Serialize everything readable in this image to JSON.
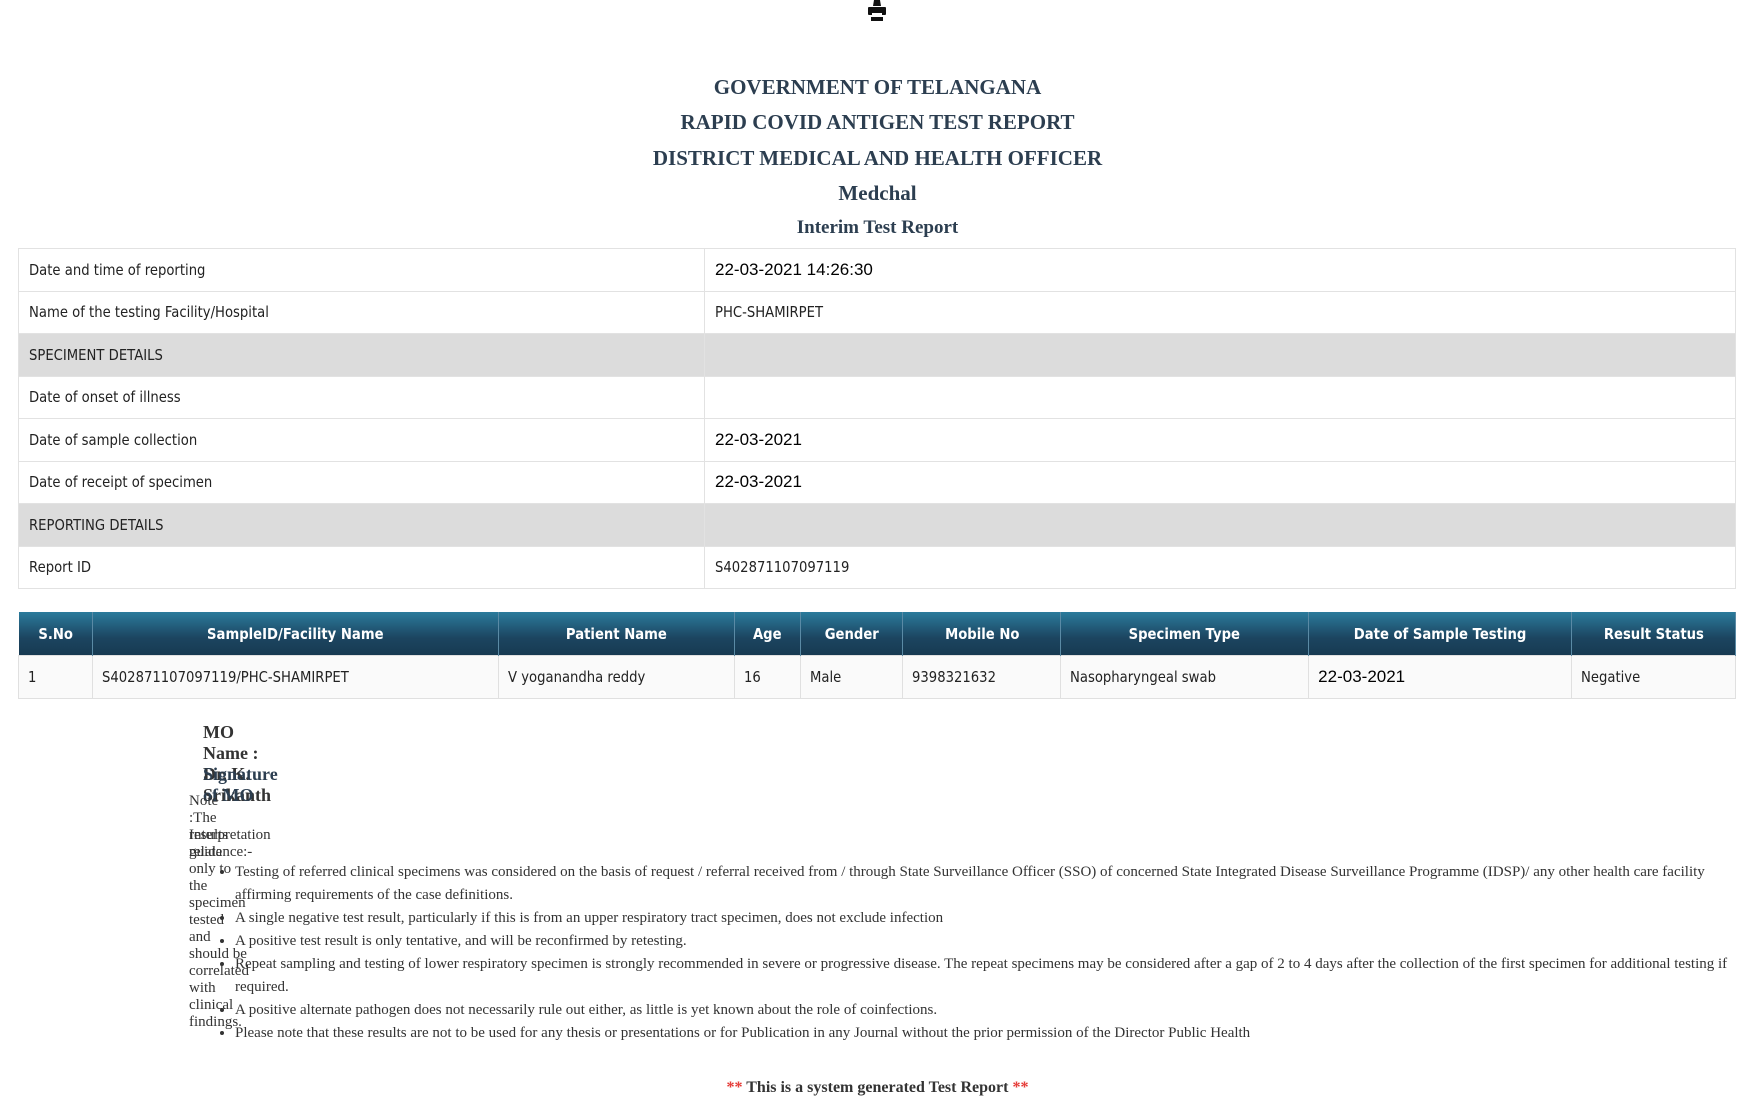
{
  "toolbar": {
    "print_icon": "printer-icon"
  },
  "header": {
    "line1": "GOVERNMENT OF TELANGANA",
    "line2": "RAPID COVID ANTIGEN TEST REPORT",
    "line3": "DISTRICT MEDICAL AND HEALTH OFFICER",
    "line4": "Medchal",
    "line5": "Interim Test Report"
  },
  "info": {
    "reporting_label": "Date and time of reporting",
    "reporting_value": "22-03-2021 14:26:30",
    "facility_label": "Name of the testing Facility/Hospital",
    "facility_value": "PHC-SHAMIRPET",
    "specimen_section": "SPECIMENT DETAILS",
    "onset_label": "Date of onset of illness",
    "onset_value": "",
    "collection_label": "Date of sample collection",
    "collection_value": "22-03-2021",
    "receipt_label": "Date of receipt of specimen",
    "receipt_value": "22-03-2021",
    "reporting_section": "REPORTING DETAILS",
    "report_id_label": "Report ID",
    "report_id_value": "S402871107097119"
  },
  "results": {
    "columns": [
      "S.No",
      "SampleID/Facility Name",
      "Patient Name",
      "Age",
      "Gender",
      "Mobile No",
      "Specimen Type",
      "Date of Sample Testing",
      "Result Status"
    ],
    "rows": [
      [
        "1",
        "S402871107097119/PHC-SHAMIRPET",
        "V yoganandha reddy",
        "16",
        "Male",
        "9398321632",
        "Nasopharyngeal swab",
        "22-03-2021",
        "Negative"
      ]
    ]
  },
  "mo": {
    "name": "MO Name : Dr. K. Srikanth",
    "signature": "Signature of MO"
  },
  "notes": {
    "note": "Note :The results relate only to the specimen tested and should be correlated with clinical findings.",
    "guidance_title": "Interpretation guidance:-",
    "items": [
      "Testing of referred clinical specimens was considered on the basis of request / referral received from / through State Surveillance Officer (SSO) of concerned State Integrated Disease Surveillance Programme (IDSP)/ any other health care facility affirming requirements of the case definitions.",
      "A single negative test result, particularly if this is from an upper respiratory tract specimen, does not exclude infection",
      "A positive test result is only tentative, and will be reconfirmed by retesting.",
      "Repeat sampling and testing of lower respiratory specimen is strongly recommended in severe or progressive disease. The repeat specimens may be considered after a gap of 2 to 4 days after the collection of the first specimen for additional testing if required.",
      "A positive alternate pathogen does not necessarily rule out either, as little is yet known about the role of coinfections.",
      "Please note that these results are not to be used for any thesis or presentations or for Publication in any Journal without the prior permission of the Director Public Health"
    ]
  },
  "footer": {
    "stars": "**",
    "text": " This is a system generated Test Report "
  },
  "colors": {
    "header_text": "#2c3e50",
    "table_header": "#1c4560",
    "section_bg": "#dcdcdc",
    "stars": "#e53935"
  }
}
